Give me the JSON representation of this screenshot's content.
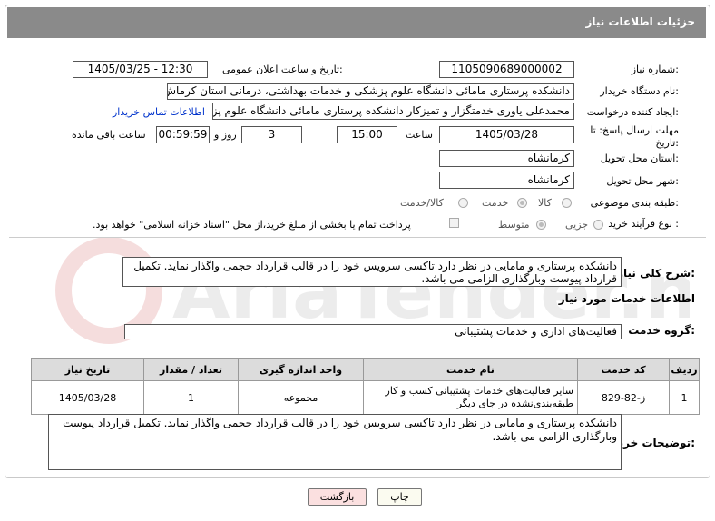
{
  "header": {
    "title": "جزئیات اطلاعات نیاز"
  },
  "fields": {
    "need_number_label": "شماره نیاز:",
    "need_number": "1105090689000002",
    "announce_label": "تاریخ و ساعت اعلان عمومی:",
    "announce_value": "1405/03/25 - 12:30",
    "buyer_org_label": "نام دستگاه خریدار:",
    "buyer_org": "دانشکده پرستاری مامائی دانشگاه علوم پزشکی و خدمات بهداشتی، درمانی استان کرماش",
    "creator_label": "ایجاد کننده درخواست:",
    "creator": "محمدعلی یاوری خدمتگزار و تمیزکار دانشکده پرستاری مامائی دانشگاه علوم پزش",
    "contact_link": "اطلاعات تماس خریدار",
    "deadline_label_1": "مهلت ارسال پاسخ: تا",
    "deadline_label_2": "تاریخ:",
    "deadline_date": "1405/03/28",
    "time_label": "ساعت",
    "deadline_time": "15:00",
    "days_value": "3",
    "days_label": "روز و",
    "remaining_time": "00:59:59",
    "remaining_label": "ساعت باقی مانده",
    "province_label": "استان محل تحویل:",
    "province": "کرمانشاه",
    "city_label": "شهر محل تحویل:",
    "city": "کرمانشاه",
    "category_label": "طبقه بندی موضوعی:",
    "category_options": [
      "کالا",
      "خدمت",
      "کالا/خدمت"
    ],
    "process_label": "نوع فرآیند خرید :",
    "process_options": [
      "جزیی",
      "متوسط"
    ],
    "payment_note": "پرداخت تمام یا بخشی از مبلغ خرید،از محل \"اسناد خزانه اسلامی\" خواهد بود."
  },
  "summary": {
    "label": "شرح کلی نیاز:",
    "text": "دانشکده پرستاری و مامایی در نظر دارد تاکسی سرویس خود را در قالب قرارداد حجمی واگذار نماید. تکمیل قرارداد پیوست وبارگذاری الزامی می باشد."
  },
  "services": {
    "section_title": "اطلاعات خدمات مورد نیاز",
    "group_label": "گروه خدمت:",
    "group_value": "فعالیت‌های اداری و خدمات پشتیبانی",
    "columns": [
      "ردیف",
      "کد خدمت",
      "نام خدمت",
      "واحد اندازه گیری",
      "تعداد / مقدار",
      "تاریخ نیاز"
    ],
    "rows": [
      [
        "1",
        "ز-82-829",
        "سایر فعالیت‌های خدمات پشتیبانی کسب و کار طبقه‌بندی‌نشده در جای دیگر",
        "مجموعه",
        "1",
        "1405/03/28"
      ]
    ]
  },
  "buyer_notes": {
    "label": "توضیحات خریدار:",
    "text": "دانشکده پرستاری و مامایی در نظر دارد تاکسی سرویس خود را در قالب قرارداد حجمی واگذار نماید. تکمیل قرارداد پیوست وبارگذاری الزامی می باشد."
  },
  "buttons": {
    "print": "چاپ",
    "back": "بازگشت"
  },
  "watermark": "AriaTender.neT"
}
